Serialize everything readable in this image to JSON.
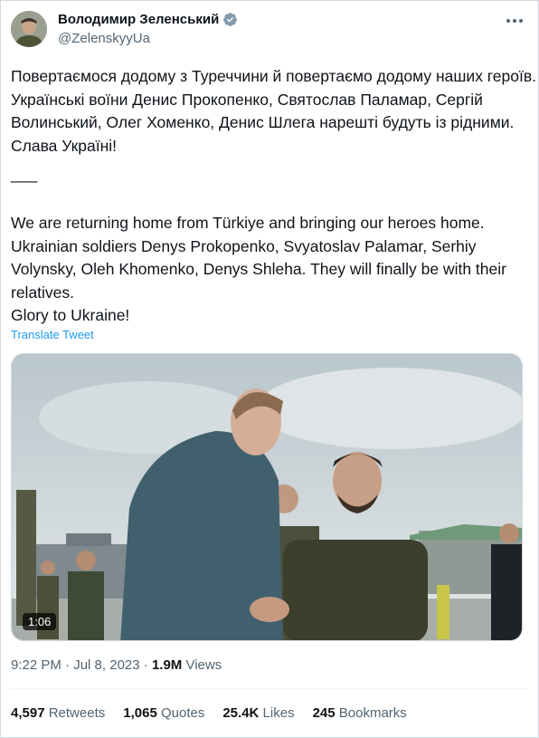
{
  "author": {
    "name": "Володимир Зеленський",
    "handle": "@ZelenskyyUa"
  },
  "tweet": {
    "uk_lines": [
      "Повертаємося додому з Туреччини й повертаємо додому наших героїв.",
      "Українські воїни Денис Прокопенко, Святослав Паламар, Сергій",
      "Волинський, Олег Хоменко, Денис Шлега нарешті будуть із рідними.",
      "Слава Україні!"
    ],
    "separator": "___",
    "en_lines": [
      "We are returning home from Türkiye and bringing our heroes home.",
      "Ukrainian soldiers Denys Prokopenko, Svyatoslav Palamar, Serhiy",
      "Volynsky, Oleh Khomenko, Denys Shleha. They will finally be with their",
      "relatives.",
      "Glory to Ukraine!"
    ],
    "translate_label": "Translate Tweet"
  },
  "video": {
    "duration": "1:06"
  },
  "meta": {
    "time": "9:22 PM",
    "dot": "·",
    "date": "Jul 8, 2023",
    "views_count": "1.9M",
    "views_label": "Views"
  },
  "stats": [
    {
      "count": "4,597",
      "label": "Retweets"
    },
    {
      "count": "1,065",
      "label": "Quotes"
    },
    {
      "count": "25.4K",
      "label": "Likes"
    },
    {
      "count": "245",
      "label": "Bookmarks"
    }
  ],
  "colors": {
    "accent": "#1d9bf0",
    "text": "#0f1419",
    "secondary": "#536471",
    "border": "#cfd9de"
  }
}
